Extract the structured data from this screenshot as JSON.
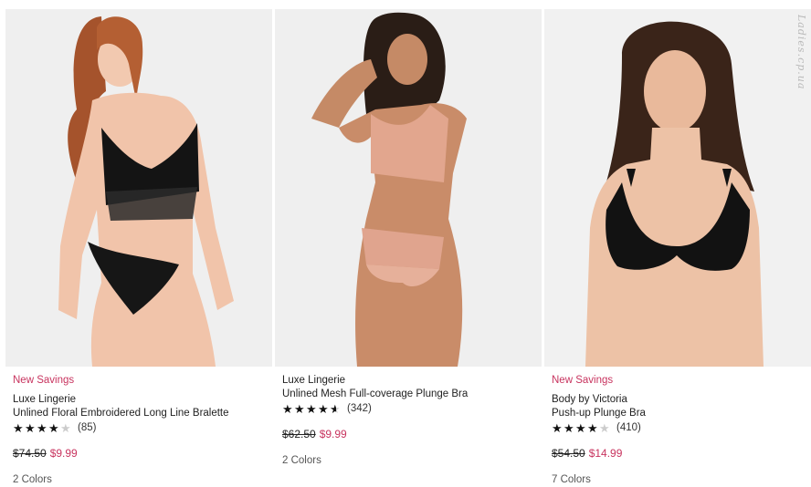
{
  "watermark": "Ladies.cp.ua",
  "accent_color": "#c8345f",
  "products": [
    {
      "badge": "New Savings",
      "collection": "Luxe Lingerie",
      "name": "Unlined Floral Embroidered Long Line Bralette",
      "rating": 4,
      "review_count": "(85)",
      "was_price": "$74.50",
      "sale_price": "$9.99",
      "colors": "2 Colors",
      "swatch": "#111111"
    },
    {
      "badge": "",
      "collection": "Luxe Lingerie",
      "name": "Unlined Mesh Full-coverage Plunge Bra",
      "rating": 4.5,
      "review_count": "(342)",
      "was_price": "$62.50",
      "sale_price": "$9.99",
      "colors": "2 Colors",
      "swatch": "#e0a48e"
    },
    {
      "badge": "New Savings",
      "collection": "Body by Victoria",
      "name": "Push-up Plunge Bra",
      "rating": 4,
      "review_count": "(410)",
      "was_price": "$54.50",
      "sale_price": "$14.99",
      "colors": "7 Colors",
      "swatch": "#111111"
    }
  ]
}
